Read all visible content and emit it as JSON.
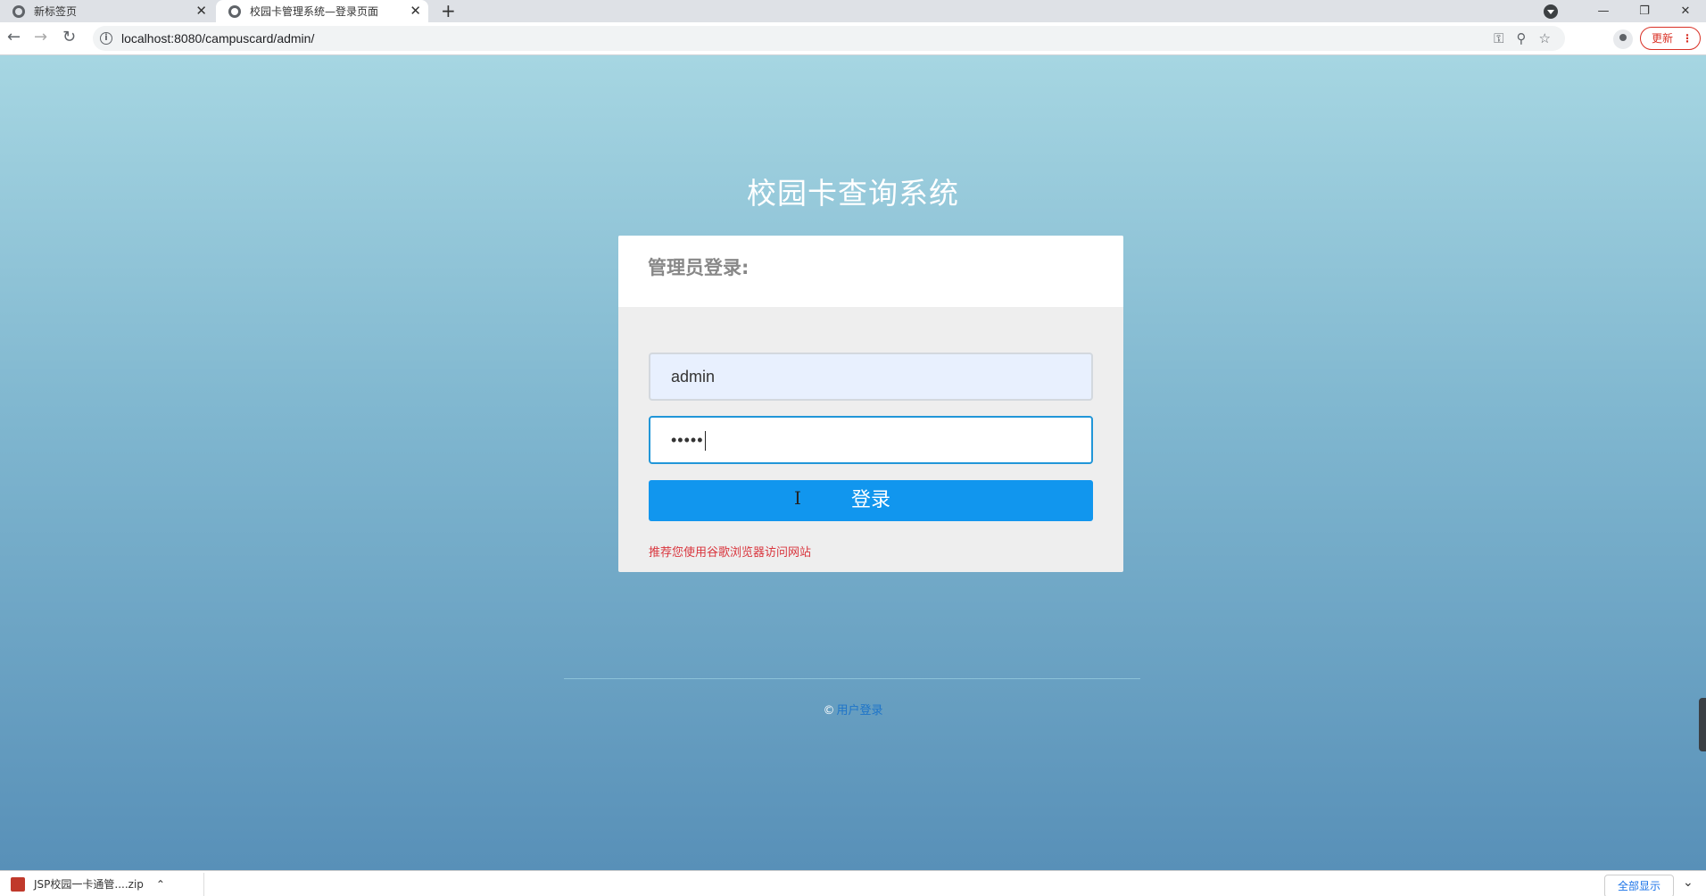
{
  "browser": {
    "tabs": [
      {
        "title": "新标签页",
        "active": false
      },
      {
        "title": "校园卡管理系统—登录页面",
        "active": true
      }
    ],
    "url": "localhost:8080/campuscard/admin/",
    "update_label": "更新"
  },
  "page": {
    "title": "校园卡查询系统",
    "panel_heading": "管理员登录:",
    "username_value": "admin",
    "password_mask": "•••••",
    "login_button": "登录",
    "hint": "推荐您使用谷歌浏览器访问网站",
    "footer_link": "用户登录",
    "footer_symbol": "©"
  },
  "download_bar": {
    "item_label": "JSP校园一卡通管....zip",
    "show_all": "全部显示"
  },
  "colors": {
    "login_button": "#1196ee",
    "hint_text": "#d9363e",
    "active_input_border": "#2196d8"
  }
}
